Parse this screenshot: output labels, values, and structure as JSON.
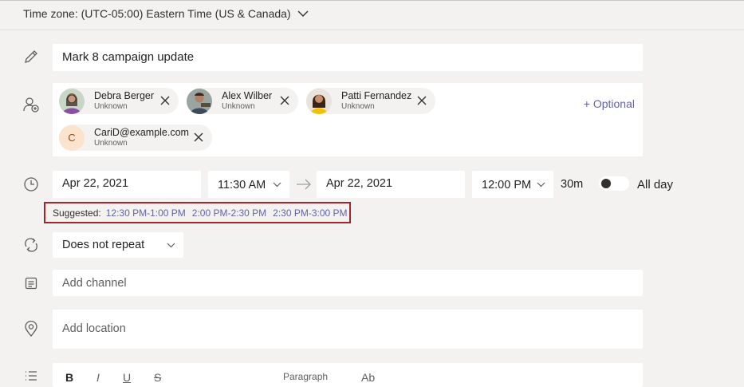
{
  "timezone": {
    "label": "Time zone: (UTC-05:00) Eastern Time (US & Canada)",
    "icon": "chevron-down-icon"
  },
  "title": {
    "value": "Mark 8 campaign update",
    "icon": "pencil-icon"
  },
  "attendees": {
    "icon": "add-person-icon",
    "optional_label": "+ Optional",
    "people": [
      {
        "name": "Debra Berger",
        "status": "Unknown"
      },
      {
        "name": "Alex Wilber",
        "status": "Unknown"
      },
      {
        "name": "Patti Fernandez",
        "status": "Unknown"
      },
      {
        "name": "CariD@example.com",
        "status": "Unknown",
        "initial": "C"
      }
    ]
  },
  "schedule": {
    "icon": "clock-icon",
    "start_date": "Apr 22, 2021",
    "start_time": "11:30 AM",
    "end_date": "Apr 22, 2021",
    "end_time": "12:00 PM",
    "duration": "30m",
    "all_day_label": "All day",
    "all_day": false
  },
  "suggested": {
    "label": "Suggested:",
    "slots": [
      "12:30 PM-1:00 PM",
      "2:00 PM-2:30 PM",
      "2:30 PM-3:00 PM"
    ],
    "highlight_color": "#a4262c"
  },
  "repeat": {
    "icon": "repeat-icon",
    "value": "Does not repeat"
  },
  "channel": {
    "icon": "channel-icon",
    "placeholder": "Add channel"
  },
  "location": {
    "icon": "location-pin-icon",
    "placeholder": "Add location"
  },
  "toolbar": {
    "icon": "list-icon",
    "items": [
      "B",
      "I",
      "U",
      "S",
      "Paragraph",
      "Ab"
    ]
  },
  "colors": {
    "accent": "#6264a7",
    "background": "#f3f2f1"
  }
}
